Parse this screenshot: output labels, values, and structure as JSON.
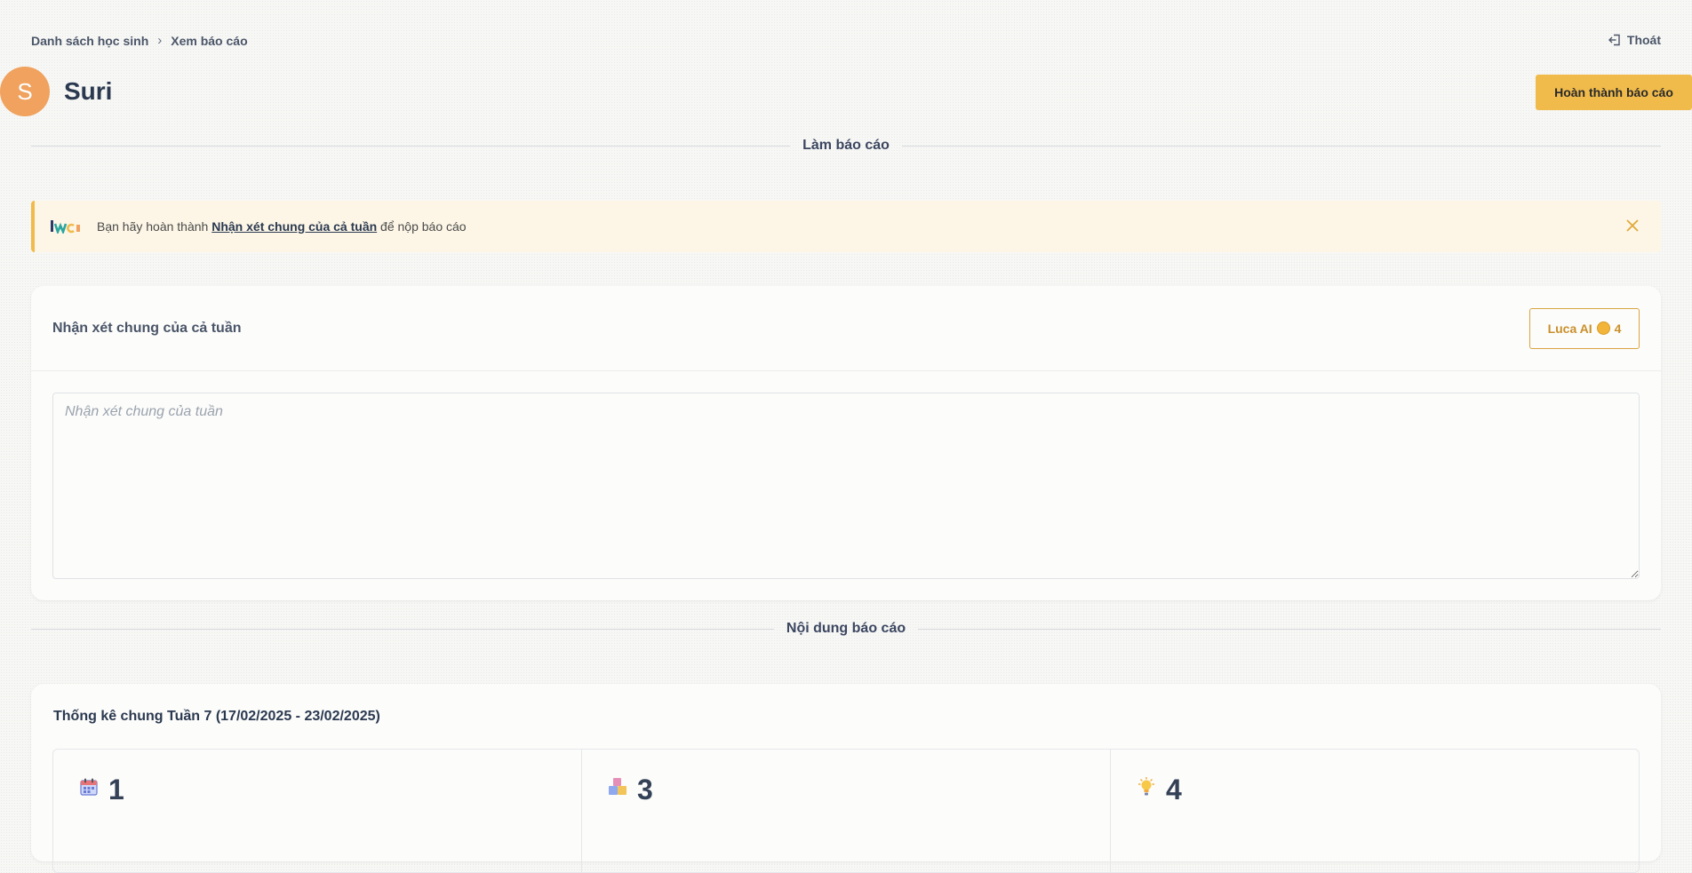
{
  "breadcrumb": {
    "items": [
      "Danh sách học sinh",
      "Xem báo cáo"
    ],
    "separator": "›"
  },
  "header": {
    "logout_label": "Thoát",
    "student_initial": "S",
    "student_name": "Suri",
    "complete_button": "Hoàn thành báo cáo"
  },
  "sections": {
    "make_report": "Làm báo cáo",
    "report_content": "Nội dung báo cáo"
  },
  "alert": {
    "prefix": "Bạn hãy hoàn thành ",
    "link": "Nhận xét chung của cả tuần",
    "suffix": " để nộp báo cáo",
    "logo_name": "luca-logo-icon"
  },
  "comment_card": {
    "title": "Nhận xét chung của cả tuần",
    "ai_button_label": "Luca AI",
    "ai_credits": "4",
    "textarea_placeholder": "Nhận xét chung của tuần",
    "textarea_value": ""
  },
  "stats_card": {
    "title": "Thống kê chung Tuần 7 (17/02/2025 - 23/02/2025)",
    "items": [
      {
        "icon": "calendar-icon",
        "value": "1"
      },
      {
        "icon": "blocks-icon",
        "value": "3"
      },
      {
        "icon": "lightbulb-icon",
        "value": "4"
      }
    ]
  },
  "colors": {
    "accent": "#f0bb4b",
    "avatar": "#f0a25e",
    "alert_bg": "#fdf6e6",
    "text_dark": "#2b3950"
  }
}
